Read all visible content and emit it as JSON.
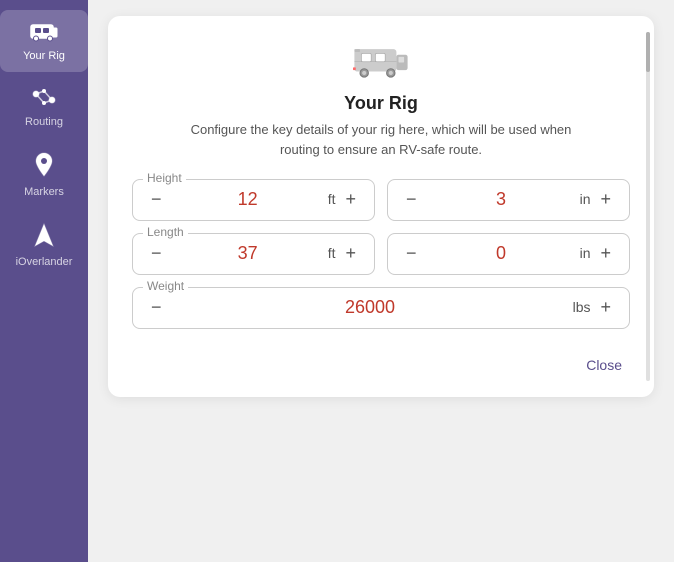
{
  "sidebar": {
    "items": [
      {
        "id": "your-rig",
        "label": "Your Rig",
        "icon": "🚌",
        "active": true
      },
      {
        "id": "routing",
        "label": "Routing",
        "icon": "⟷",
        "active": false
      },
      {
        "id": "markers",
        "label": "Markers",
        "icon": "📍",
        "active": false
      },
      {
        "id": "ioverlander",
        "label": "iOverlander",
        "icon": "⬆",
        "active": false
      }
    ]
  },
  "modal": {
    "title": "Your Rig",
    "description": "Configure the key details of your rig here, which will be used when routing to ensure an RV-safe route.",
    "height": {
      "label": "Height",
      "ft_value": "12",
      "in_value": "3",
      "ft_unit": "ft",
      "in_unit": "in"
    },
    "length": {
      "label": "Length",
      "ft_value": "37",
      "in_value": "0",
      "ft_unit": "ft",
      "in_unit": "in"
    },
    "weight": {
      "label": "Weight",
      "value": "26000",
      "unit": "lbs"
    },
    "close_label": "Close",
    "minus_label": "−",
    "plus_label": "+"
  }
}
